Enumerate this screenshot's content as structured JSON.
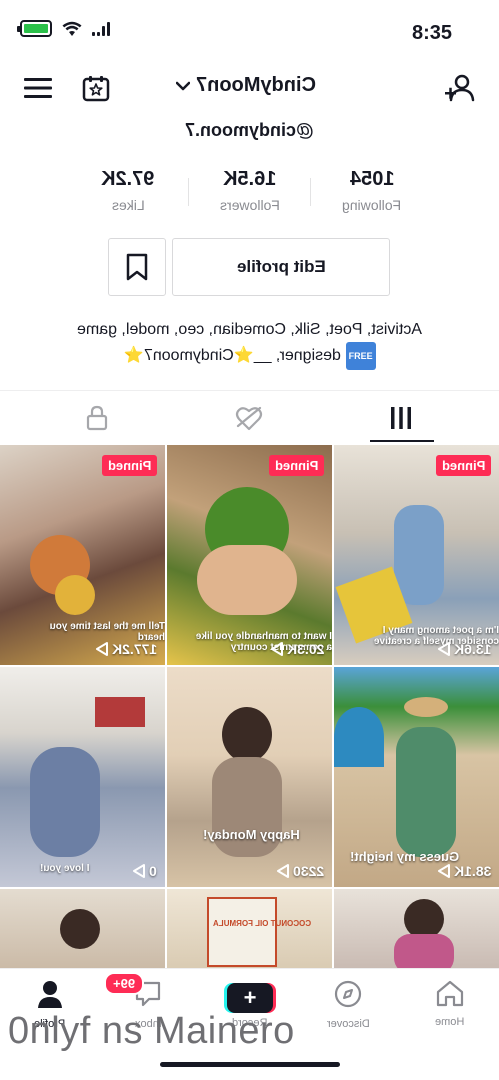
{
  "status_bar": {
    "time": "8:35"
  },
  "header": {
    "username": "CindyMoon7",
    "handle": "@cindymoon.7"
  },
  "stats": [
    {
      "value": "1054",
      "label": "Following"
    },
    {
      "value": "16.5K",
      "label": "Followers"
    },
    {
      "value": "97.2K",
      "label": "Likes"
    }
  ],
  "actions": {
    "edit_profile": "Edit profile"
  },
  "bio": {
    "line1": "Activist, Poet, Silk, Comedian, ceo, model, game",
    "line2": "designer, __⭐Cindymoon7⭐",
    "badge": "FREE"
  },
  "tabs": [
    {
      "icon": "grid-icon",
      "active": true
    },
    {
      "icon": "liked-heart-icon",
      "active": false
    },
    {
      "icon": "lock-icon",
      "active": false
    }
  ],
  "videos": [
    {
      "pinned_label": "Pinned",
      "views": "177.2K",
      "caption": "Tell me the last time you heard"
    },
    {
      "pinned_label": "Pinned",
      "views": "20.3K",
      "caption": "I want to manhandle you like a communist country"
    },
    {
      "pinned_label": "Pinned",
      "views": "13.6K",
      "caption": "I'm a poet among many I consider myself a creative"
    },
    {
      "pinned_label": "",
      "views": "0",
      "caption": "I love you!"
    },
    {
      "pinned_label": "",
      "views": "2230",
      "caption": "Happy Monday!"
    },
    {
      "pinned_label": "",
      "views": "38.1K",
      "caption": "Guess my height!"
    },
    {
      "pinned_label": "",
      "views": "",
      "caption": ""
    },
    {
      "pinned_label": "",
      "views": "",
      "caption": "COCONUT OIL FORMULA"
    },
    {
      "pinned_label": "",
      "views": "",
      "caption": ""
    }
  ],
  "bottom_nav": {
    "home": "Home",
    "discover": "Discover",
    "record": "Record",
    "inbox": "Inbox",
    "inbox_badge": "99+",
    "profile": "Profile"
  },
  "watermark": "0nlyf ns Mainero",
  "colors": {
    "accent_red": "#fe2c55",
    "accent_cyan": "#25f4ee",
    "text_primary": "#161823",
    "text_secondary": "#8a8b91"
  }
}
